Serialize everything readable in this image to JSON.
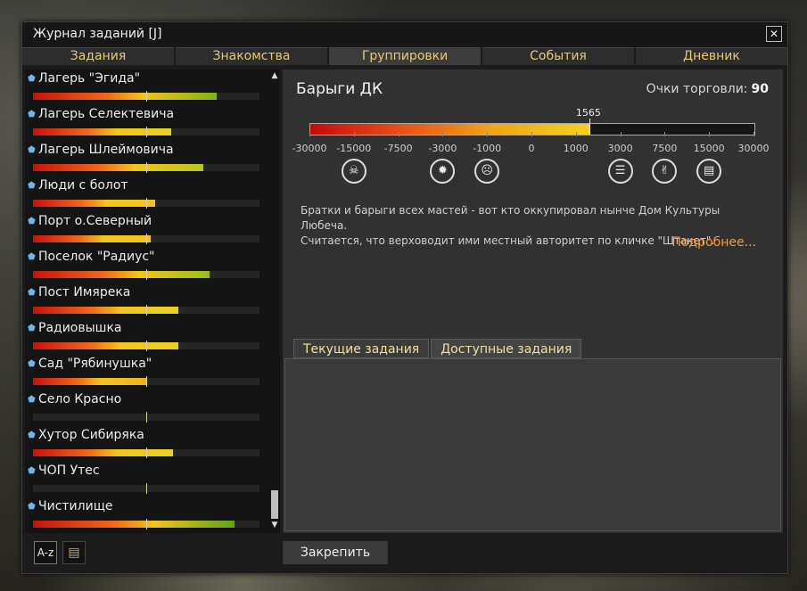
{
  "window": {
    "title": "Журнал заданий [J]",
    "close_label": "✕"
  },
  "tabs": [
    {
      "label": "Задания"
    },
    {
      "label": "Знакомства"
    },
    {
      "label": "Группировки",
      "active": true
    },
    {
      "label": "События"
    },
    {
      "label": "Дневник"
    }
  ],
  "factions": [
    {
      "name": "Лагерь \"Эгида\"",
      "fill": 0.81,
      "tail": "#7fb21a"
    },
    {
      "name": "Лагерь Селектевича",
      "fill": 0.61,
      "tail": "#e8d21c"
    },
    {
      "name": "Лагерь Шлеймовича",
      "fill": 0.75,
      "tail": "#b6c81a"
    },
    {
      "name": "Люди с болот",
      "fill": 0.54,
      "tail": "#f2c41c"
    },
    {
      "name": "Порт о.Северный",
      "fill": 0.52,
      "tail": "#f2c41c"
    },
    {
      "name": "Поселок \"Радиус\"",
      "fill": 0.78,
      "tail": "#98bf1a"
    },
    {
      "name": "Пост Имярека",
      "fill": 0.64,
      "tail": "#e8d21c"
    },
    {
      "name": "Радиовышка",
      "fill": 0.64,
      "tail": "#e8d21c"
    },
    {
      "name": "Сад \"Рябинушка\"",
      "fill": 0.5,
      "tail": "#f0b41c"
    },
    {
      "name": "Село Красно",
      "fill": 0.0,
      "tail": "#f0b41c"
    },
    {
      "name": "Хутор Сибиряка",
      "fill": 0.62,
      "tail": "#e8d21c"
    },
    {
      "name": "ЧОП Утес",
      "fill": 0.0,
      "tail": "#f0b41c"
    },
    {
      "name": "Чистилище",
      "fill": 0.89,
      "tail": "#5ea21a"
    }
  ],
  "bottom_buttons": {
    "sort_label": "A-z"
  },
  "faction_detail": {
    "name": "Барыги ДК",
    "trade_label": "Очки торговли:",
    "trade_points": "90",
    "reputation": 1565,
    "reputation_label": "1565",
    "scale": [
      "-30000",
      "-15000",
      "-7500",
      "-3000",
      "-1000",
      "0",
      "1000",
      "3000",
      "7500",
      "15000",
      "30000"
    ],
    "icons": [
      {
        "name": "skull-icon",
        "at": "-15000",
        "glyph": "☠"
      },
      {
        "name": "bug-icon",
        "at": "-3000",
        "glyph": "✹"
      },
      {
        "name": "frown-icon",
        "at": "-1000",
        "glyph": "☹"
      },
      {
        "name": "list-icon",
        "at": "3000",
        "glyph": "☰"
      },
      {
        "name": "handshake-icon",
        "at": "7500",
        "glyph": "✌"
      },
      {
        "name": "document-icon",
        "at": "15000",
        "glyph": "▤"
      }
    ],
    "description_line1": "Братки и барыги всех мастей - вот кто оккупировал нынче Дом Культуры Любеча.",
    "description_line2": "Считается, что верховодит ими местный авторитет по кличке \"Штакет\".",
    "more_label": "Подробнее..."
  },
  "subtabs": [
    {
      "label": "Текущие задания",
      "active": true
    },
    {
      "label": "Доступные задания"
    }
  ],
  "pin_label": "Закрепить"
}
